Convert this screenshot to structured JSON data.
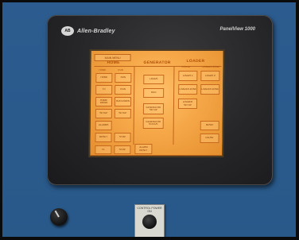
{
  "panel": {
    "brand": "Allen-Bradley",
    "logo": "AB",
    "model": "PanelView 1000"
  },
  "screen": {
    "title": "MAIN MENU",
    "sections": {
      "left": "HOME",
      "middle": "GENERATOR",
      "right": "LOADER"
    },
    "subheaders": {
      "left_a": "HOME",
      "left_b": "RUN",
      "right_a": "PICKUP",
      "right_b": "LOADER ZONE"
    },
    "left_buttons": [
      "HOME",
      "RUN",
      "TC",
      "RUN",
      "HOME DOWN",
      "RUN DOWN",
      "SETUP",
      "SETUP",
      "ALARMS",
      "",
      "RESET",
      "STOP"
    ],
    "middle_buttons": [
      "LOADS",
      "RUN",
      "GENERATOR SETUP",
      "GENERATOR STATUS"
    ],
    "right_buttons": [
      "LOADS 1",
      "LOADS 2",
      "LOADER ZONE",
      "LOADER ZONE",
      "LOADER SETUP",
      "RESET",
      "PAUSE"
    ],
    "bottom_buttons": [
      "F1",
      "STOP",
      "ALARM RESET"
    ]
  },
  "controls": {
    "plate_label": "CONTROL POWER ON"
  }
}
